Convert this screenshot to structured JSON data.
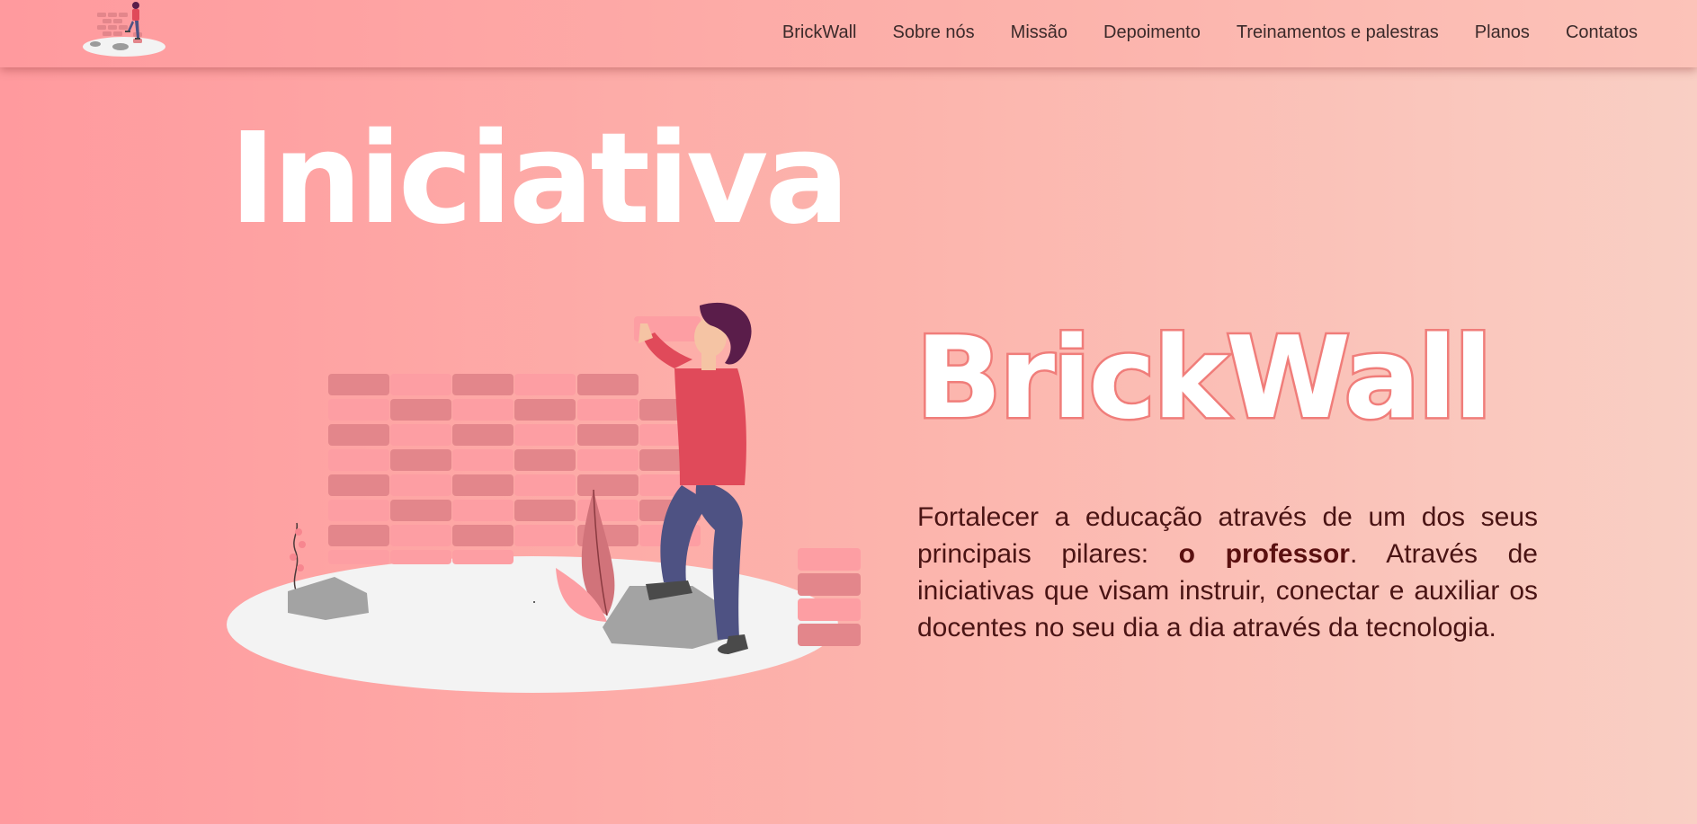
{
  "nav": {
    "logo_alt": "BrickWall logo",
    "items": [
      {
        "label": "BrickWall"
      },
      {
        "label": "Sobre nós"
      },
      {
        "label": "Missão"
      },
      {
        "label": "Depoimento"
      },
      {
        "label": "Treinamentos e palestras"
      },
      {
        "label": "Planos"
      },
      {
        "label": "Contatos"
      }
    ]
  },
  "hero": {
    "headline": "Iniciativa",
    "brand": "BrickWall",
    "description": {
      "part1": "Fortalecer a educação através de um dos seus principais pilares: ",
      "emphasis": "o professor",
      "part2": ". Através de iniciativas que visam instruir, conectar e auxiliar os docentes no seu dia a dia através da tecnologia."
    }
  },
  "colors": {
    "background_start": "#ff9a9e",
    "background_end": "#f9cfc4",
    "brand_outline": "#f07d7a",
    "text_dark": "#4a1414",
    "shirt": "#e04a5a",
    "pants": "#4e5283",
    "hair": "#5a1d4a"
  }
}
